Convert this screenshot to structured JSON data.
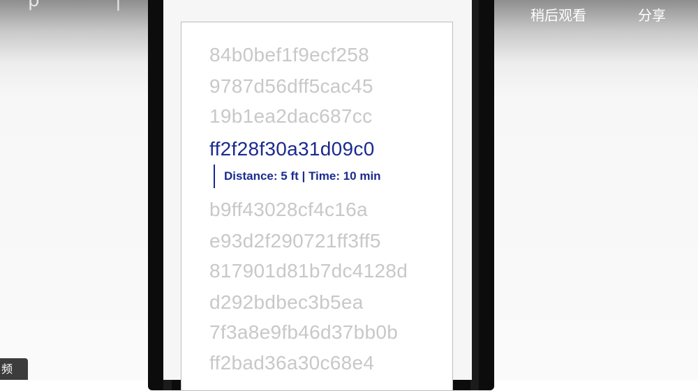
{
  "overlay": {
    "watch_later": "稍后观看",
    "share": "分享",
    "corner_tag": "频"
  },
  "hash_list": {
    "before": [
      "84b0bef1f9ecf258",
      "9787d56dff5cac45",
      "19b1ea2dac687cc"
    ],
    "active": "ff2f28f30a31d09c0",
    "active_detail": "Distance: 5 ft | Time: 10 min",
    "after": [
      "b9ff43028cf4c16a",
      "e93d2f290721ff3ff5",
      "817901d81b7dc4128d",
      "d292bdbec3b5ea",
      "7f3a8e9fb46d37bb0b",
      "ff2bad36a30c68e4"
    ]
  },
  "colors": {
    "active_text": "#1b2a8f",
    "inactive_text": "#c8c8c8",
    "phone_frame": "#0c0c0c"
  }
}
